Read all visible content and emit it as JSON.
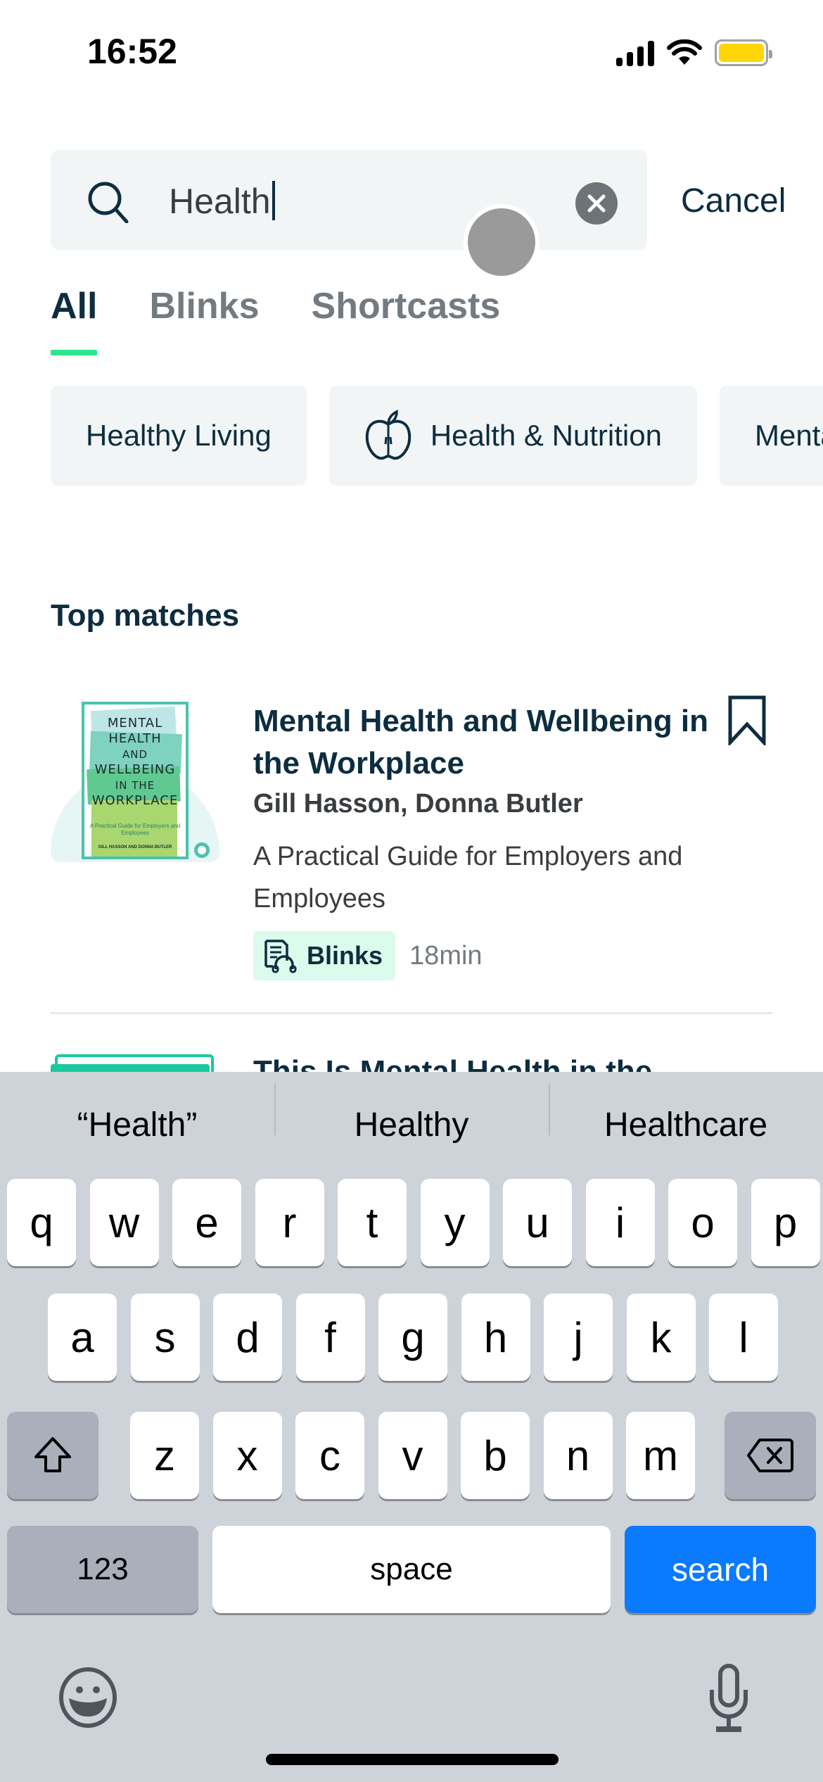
{
  "status_bar": {
    "time": "16:52",
    "icons": [
      "cellular-signal-icon",
      "wifi-icon",
      "battery-icon"
    ],
    "battery_color": "#ffd60a"
  },
  "search": {
    "value": "Health",
    "placeholder": "",
    "icon": "search-icon",
    "clear_icon": "clear-icon",
    "cancel_label": "Cancel"
  },
  "tabs": [
    {
      "label": "All",
      "active": true
    },
    {
      "label": "Blinks",
      "active": false
    },
    {
      "label": "Shortcasts",
      "active": false
    }
  ],
  "chips": [
    {
      "label": "Healthy Living",
      "icon": null
    },
    {
      "label": "Health & Nutrition",
      "icon": "apple-icon"
    },
    {
      "label": "Mental Health",
      "icon": null,
      "partially_visible": "Mer"
    }
  ],
  "top_matches": {
    "title": "Top matches",
    "results": [
      {
        "title": "Mental Health and Wellbeing in the Workplace",
        "author": "Gill Hasson, Donna Butler",
        "subtitle": "A Practical Guide for Employers and Employees",
        "type": "Blinks",
        "duration": "18min",
        "cover": {
          "lines": [
            "MENTAL",
            "HEALTH",
            "AND",
            "WELLBEING",
            "IN THE",
            "WORKPLACE"
          ],
          "tagline": "A Practical Guide for Employers and Employees",
          "authors": "GILL HASSON AND DONNA BUTLER"
        },
        "bookmarked": false
      },
      {
        "title": "This Is Mental Health in the",
        "partially_visible": true
      }
    ]
  },
  "keyboard": {
    "suggestions": [
      "“Health”",
      "Healthy",
      "Healthcare"
    ],
    "rows": [
      [
        "q",
        "w",
        "e",
        "r",
        "t",
        "y",
        "u",
        "i",
        "o",
        "p"
      ],
      [
        "a",
        "s",
        "d",
        "f",
        "g",
        "h",
        "j",
        "k",
        "l"
      ],
      [
        "z",
        "x",
        "c",
        "v",
        "b",
        "n",
        "m"
      ]
    ],
    "numbers_label": "123",
    "space_label": "space",
    "action_label": "search",
    "action_color": "#0a7aff"
  },
  "colors": {
    "brand_dark": "#0d2d3f",
    "accent_green": "#2ee58c",
    "badge_bg": "#dcfbec"
  }
}
